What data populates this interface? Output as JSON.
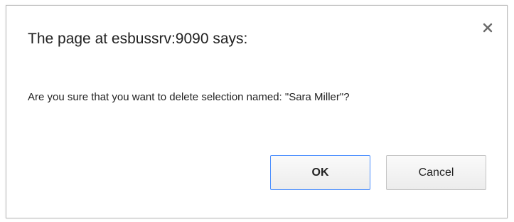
{
  "dialog": {
    "title": "The page at esbussrv:9090 says:",
    "message": "Are you sure that you want to delete selection named: \"Sara Miller\"?",
    "close_icon": "close-icon",
    "ok_label": "OK",
    "cancel_label": "Cancel"
  },
  "colors": {
    "border": "#b9b9b9",
    "focus_border": "#4d90fe",
    "text": "#222222"
  }
}
